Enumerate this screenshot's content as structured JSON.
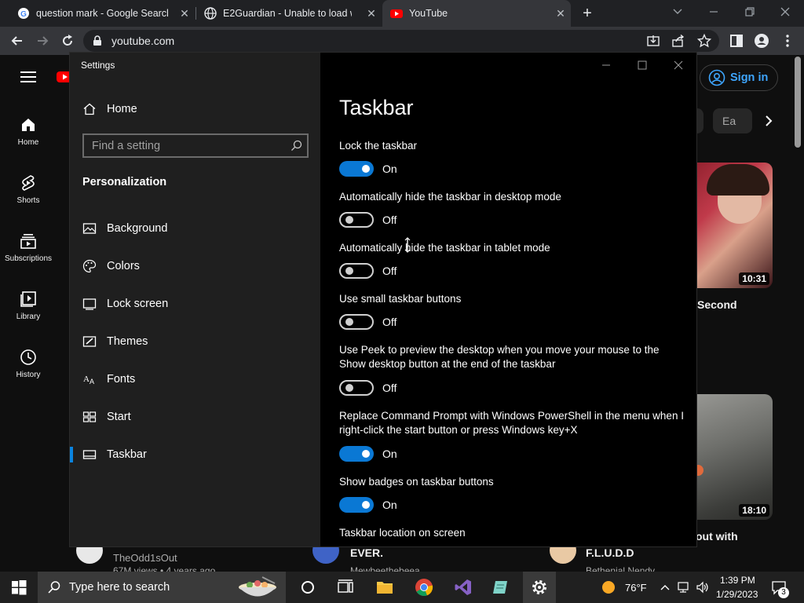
{
  "browser": {
    "tabs": [
      {
        "title": "question mark - Google Search"
      },
      {
        "title": "E2Guardian - Unable to load web"
      },
      {
        "title": "YouTube"
      }
    ],
    "url": "youtube.com"
  },
  "youtube": {
    "sign_in": "Sign in",
    "nav": [
      {
        "label": "Home"
      },
      {
        "label": "Shorts"
      },
      {
        "label": "Subscriptions"
      },
      {
        "label": "Library"
      },
      {
        "label": "History"
      }
    ],
    "chip": "Ea",
    "videos": [
      {
        "duration": "10:31",
        "title_fragment": "Second"
      },
      {
        "duration": "18:10",
        "title_fragment": "out with"
      }
    ],
    "bottom_row": [
      {
        "channel": "TheOdd1sOut",
        "meta": "67M views • 4 years ago"
      },
      {
        "title_fragment": "EVER.",
        "channel": "Mewbeethebeea"
      },
      {
        "title_fragment": "F.L.U.D.D",
        "channel": "Bethenial Nendy"
      }
    ]
  },
  "settings": {
    "window_title": "Settings",
    "home_label": "Home",
    "search_placeholder": "Find a setting",
    "group_label": "Personalization",
    "nav": [
      {
        "label": "Background",
        "icon": "picture-icon"
      },
      {
        "label": "Colors",
        "icon": "palette-icon"
      },
      {
        "label": "Lock screen",
        "icon": "lock-screen-icon"
      },
      {
        "label": "Themes",
        "icon": "brush-icon"
      },
      {
        "label": "Fonts",
        "icon": "font-icon"
      },
      {
        "label": "Start",
        "icon": "start-icon"
      },
      {
        "label": "Taskbar",
        "icon": "taskbar-icon",
        "selected": true
      }
    ],
    "page_title": "Taskbar",
    "options": [
      {
        "label": "Lock the taskbar",
        "state": "On"
      },
      {
        "label": "Automatically hide the taskbar in desktop mode",
        "state": "Off"
      },
      {
        "label": "Automatically hide the taskbar in tablet mode",
        "state": "Off"
      },
      {
        "label": "Use small taskbar buttons",
        "state": "Off"
      },
      {
        "label": "Use Peek to preview the desktop when you move your mouse to the Show desktop button at the end of the taskbar",
        "state": "Off"
      },
      {
        "label": "Replace Command Prompt with Windows PowerShell in the menu when I right-click the start button or press Windows key+X",
        "state": "On"
      },
      {
        "label": "Show badges on taskbar buttons",
        "state": "On"
      }
    ],
    "next_heading": "Taskbar location on screen"
  },
  "taskbar": {
    "search_placeholder": "Type here to search",
    "weather": "76°F",
    "time": "1:39 PM",
    "date": "1/29/2023",
    "notification_count": "3"
  },
  "colors": {
    "accent": "#0a78d4",
    "youtube_red": "#ff0000",
    "link_blue": "#3ea6ff"
  }
}
